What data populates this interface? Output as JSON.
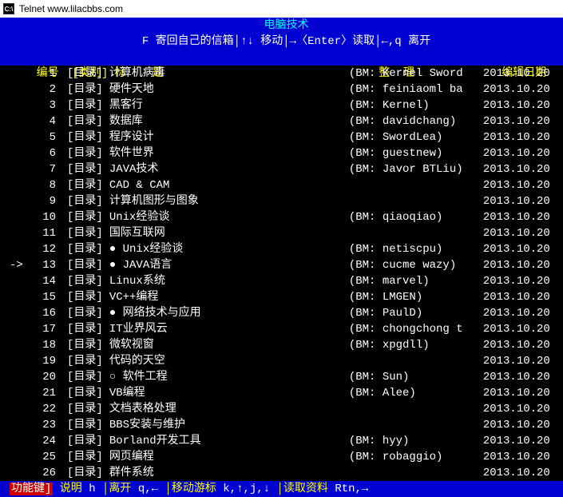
{
  "window": {
    "icon_label": "C:\\",
    "title": "Telnet www.lilacbbs.com"
  },
  "board_title": "电脑技术",
  "help_line": "F 寄回自己的信箱│↑↓ 移动│→〈Enter〉读取│←,q 离开",
  "headers": {
    "num": "编号",
    "cat": "[类别]",
    "topic": "标    题",
    "org": "整  理",
    "date": "编辑日期"
  },
  "rows": [
    {
      "ptr": "",
      "n": "1",
      "cat": "[目录]",
      "topic": "计算机病毒",
      "bm": "(BM: Kernel Sword",
      "date": "2013.10.20"
    },
    {
      "ptr": "",
      "n": "2",
      "cat": "[目录]",
      "topic": "硬件天地",
      "bm": "(BM: feiniaoml ba",
      "date": "2013.10.20"
    },
    {
      "ptr": "",
      "n": "3",
      "cat": "[目录]",
      "topic": "黑客行",
      "bm": "(BM: Kernel)",
      "date": "2013.10.20"
    },
    {
      "ptr": "",
      "n": "4",
      "cat": "[目录]",
      "topic": "数据库",
      "bm": "(BM: davidchang)",
      "date": "2013.10.20"
    },
    {
      "ptr": "",
      "n": "5",
      "cat": "[目录]",
      "topic": "程序设计",
      "bm": "(BM: SwordLea)",
      "date": "2013.10.20"
    },
    {
      "ptr": "",
      "n": "6",
      "cat": "[目录]",
      "topic": "软件世界",
      "bm": "(BM: guestnew)",
      "date": "2013.10.20"
    },
    {
      "ptr": "",
      "n": "7",
      "cat": "[目录]",
      "topic": "JAVA技术",
      "bm": "(BM: Javor BTLiu)",
      "date": "2013.10.20"
    },
    {
      "ptr": "",
      "n": "8",
      "cat": "[目录]",
      "topic": "CAD & CAM",
      "bm": "",
      "date": "2013.10.20"
    },
    {
      "ptr": "",
      "n": "9",
      "cat": "[目录]",
      "topic": "计算机图形与图象",
      "bm": "",
      "date": "2013.10.20"
    },
    {
      "ptr": "",
      "n": "10",
      "cat": "[目录]",
      "topic": "Unix经验谈",
      "bm": "(BM: qiaoqiao)",
      "date": "2013.10.20"
    },
    {
      "ptr": "",
      "n": "11",
      "cat": "[目录]",
      "topic": "国际互联网",
      "bm": "",
      "date": "2013.10.20"
    },
    {
      "ptr": "",
      "n": "12",
      "cat": "[目录]",
      "topic": "● Unix经验谈",
      "bm": "(BM: netiscpu)",
      "date": "2013.10.20"
    },
    {
      "ptr": "->",
      "n": "13",
      "cat": "[目录]",
      "topic": "● JAVA语言",
      "bm": "(BM: cucme wazy)",
      "date": "2013.10.20"
    },
    {
      "ptr": "",
      "n": "14",
      "cat": "[目录]",
      "topic": "Linux系统",
      "bm": "(BM: marvel)",
      "date": "2013.10.20"
    },
    {
      "ptr": "",
      "n": "15",
      "cat": "[目录]",
      "topic": "VC++编程",
      "bm": "(BM: LMGEN)",
      "date": "2013.10.20"
    },
    {
      "ptr": "",
      "n": "16",
      "cat": "[目录]",
      "topic": "● 网络技术与应用",
      "bm": "(BM: PaulD)",
      "date": "2013.10.20"
    },
    {
      "ptr": "",
      "n": "17",
      "cat": "[目录]",
      "topic": "IT业界风云",
      "bm": "(BM: chongchong t",
      "date": "2013.10.20"
    },
    {
      "ptr": "",
      "n": "18",
      "cat": "[目录]",
      "topic": "微软视窗",
      "bm": "(BM: xpgdll)",
      "date": "2013.10.20"
    },
    {
      "ptr": "",
      "n": "19",
      "cat": "[目录]",
      "topic": "代码的天空",
      "bm": "",
      "date": "2013.10.20"
    },
    {
      "ptr": "",
      "n": "20",
      "cat": "[目录]",
      "topic": "○ 软件工程",
      "bm": "(BM: Sun)",
      "date": "2013.10.20"
    },
    {
      "ptr": "",
      "n": "21",
      "cat": "[目录]",
      "topic": "VB编程",
      "bm": "(BM: Alee)",
      "date": "2013.10.20"
    },
    {
      "ptr": "",
      "n": "22",
      "cat": "[目录]",
      "topic": "文档表格处理",
      "bm": "",
      "date": "2013.10.20"
    },
    {
      "ptr": "",
      "n": "23",
      "cat": "[目录]",
      "topic": "BBS安装与维护",
      "bm": "",
      "date": "2013.10.20"
    },
    {
      "ptr": "",
      "n": "24",
      "cat": "[目录]",
      "topic": "Borland开发工具",
      "bm": "(BM: hyy)",
      "date": "2013.10.20"
    },
    {
      "ptr": "",
      "n": "25",
      "cat": "[目录]",
      "topic": "网页编程",
      "bm": "(BM: robaggio)",
      "date": "2013.10.20"
    },
    {
      "ptr": "",
      "n": "26",
      "cat": "[目录]",
      "topic": "群件系统",
      "bm": "",
      "date": "2013.10.20"
    }
  ],
  "footer": {
    "hotkey": "功能键]",
    "help_label": " 说明 ",
    "help_key": "h",
    "quit_label": " │离开 ",
    "quit_key": "q,←",
    "move_label": " │移动游标 ",
    "move_key": "k,↑,j,↓",
    "read_label": " │读取资料 ",
    "read_key": "Rtn,→"
  }
}
